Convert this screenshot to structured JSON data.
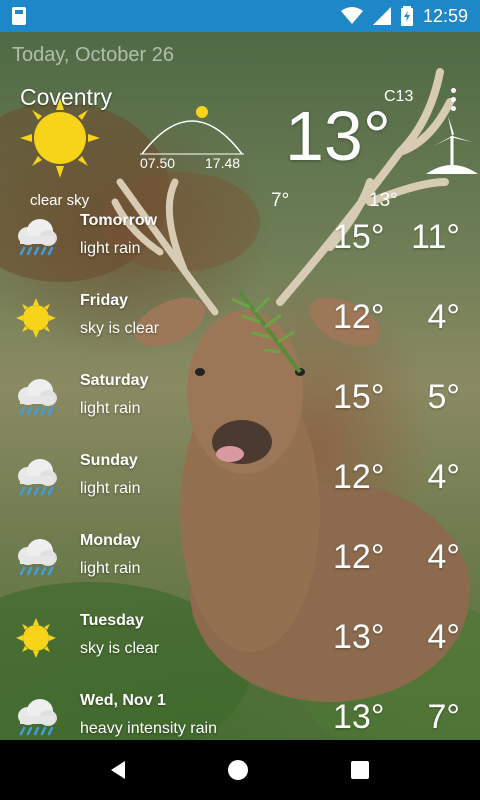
{
  "status_bar": {
    "time": "12:59"
  },
  "header": {
    "date": "Today, October 26",
    "city": "Coventry",
    "sunrise": "07.50",
    "sunset": "17.48",
    "current_temp": "13°",
    "unit_badge": "C13",
    "current_desc": "clear sky",
    "today_low": "7°",
    "today_high": "13°"
  },
  "forecast": [
    {
      "day": "Tomorrow",
      "desc": "light rain",
      "hi": "15°",
      "lo": "11°",
      "icon": "rain-cloud-icon"
    },
    {
      "day": "Friday",
      "desc": "sky is clear",
      "hi": "12°",
      "lo": "4°",
      "icon": "sun-icon"
    },
    {
      "day": "Saturday",
      "desc": "light rain",
      "hi": "15°",
      "lo": "5°",
      "icon": "rain-cloud-icon"
    },
    {
      "day": "Sunday",
      "desc": "light rain",
      "hi": "12°",
      "lo": "4°",
      "icon": "rain-cloud-icon"
    },
    {
      "day": "Monday",
      "desc": "light rain",
      "hi": "12°",
      "lo": "4°",
      "icon": "rain-cloud-icon"
    },
    {
      "day": "Tuesday",
      "desc": "sky is clear",
      "hi": "13°",
      "lo": "4°",
      "icon": "sun-icon"
    },
    {
      "day": "Wed, Nov 1",
      "desc": "heavy intensity rain",
      "hi": "13°",
      "lo": "7°",
      "icon": "rain-cloud-icon"
    }
  ],
  "colors": {
    "status_bar": "#1e87c8",
    "sun": "#f7d319",
    "rain": "#3f9fe0"
  }
}
